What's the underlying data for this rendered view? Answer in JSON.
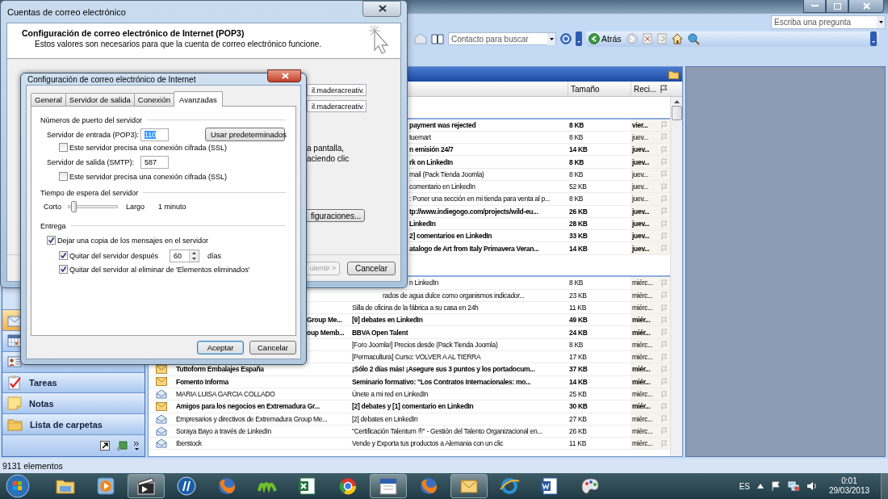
{
  "outlook": {
    "question_box": {
      "placeholder": "Escriba una pregunta"
    },
    "contact_search": {
      "placeholder": "Contacto para buscar"
    },
    "back_button": "Atrás",
    "navigation": [
      {
        "kind": "mail",
        "selected": true
      },
      {
        "kind": "calendar",
        "selected": false
      },
      {
        "kind": "contacts",
        "selected": false
      },
      {
        "kind": "tasks",
        "label": "Tareas",
        "selected": false
      },
      {
        "kind": "notes",
        "label": "Notas",
        "selected": false
      },
      {
        "kind": "folders",
        "label": "Lista de carpetas",
        "selected": false
      }
    ],
    "mail_list": {
      "columns": [
        "Tamaño",
        "Reci..."
      ],
      "groups": [
        {
          "rows": [
            {
              "kind": "subject_c",
              "subject": "payment was rejected",
              "size": "8 KB",
              "received": "vier...",
              "unread": true
            },
            {
              "kind": "subject_c",
              "subject": "tuemart",
              "size": "8 KB",
              "received": "juev...",
              "unread": false
            },
            {
              "kind": "subject_c",
              "subject": "n emisión 24/7",
              "size": "14 KB",
              "received": "juev...",
              "unread": true
            },
            {
              "kind": "subject_c",
              "subject": "rk on LinkedIn",
              "size": "8 KB",
              "received": "juev...",
              "unread": true
            },
            {
              "kind": "subject_c",
              "subject": "mail (Pack Tienda Joomla)",
              "size": "8 KB",
              "received": "juev...",
              "unread": false
            },
            {
              "kind": "subject_c",
              "subject": "comentario en LinkedIn",
              "size": "52 KB",
              "received": "juev...",
              "unread": false
            },
            {
              "kind": "subject_c",
              "subject": ": Poner una sección en mi tienda para venta al p...",
              "size": "8 KB",
              "received": "juev...",
              "unread": false
            },
            {
              "kind": "subject_c",
              "subject": "tp://www.indiegogo.com/projects/wild-eu...",
              "size": "26 KB",
              "received": "juev...",
              "unread": true
            },
            {
              "kind": "subject_c",
              "subject": "LinkedIn",
              "size": "28 KB",
              "received": "juev...",
              "unread": true
            },
            {
              "kind": "subject_c",
              "subject": "2] comentarios en LinkedIn",
              "size": "33 KB",
              "received": "juev...",
              "unread": true
            },
            {
              "kind": "subject_c",
              "subject": "atalogo de Art from Italy Primavera Veran...",
              "size": "14 KB",
              "received": "juev...",
              "unread": true
            }
          ]
        },
        {
          "rows": [
            {
              "kind": "subject_c",
              "subject": "n LinkedIn",
              "size": "8 KB",
              "received": "miérc...",
              "unread": false
            },
            {
              "kind": "subject_b",
              "subject": "rados de agua dulce como organismos indicador...",
              "size": "23 KB",
              "received": "miérc...",
              "unread": false
            },
            {
              "kind": "subject_a",
              "subject": "Silla de oficina de la fábrica a su casa en 24h",
              "size": "11 KB",
              "received": "miérc...",
              "unread": false
            },
            {
              "kind": "sender_cut",
              "sender": "Group Me...",
              "subject": "[9] debates en LinkedIn",
              "size": "49 KB",
              "received": "miér...",
              "unread": true
            },
            {
              "kind": "sender_cut",
              "sender": "oup Memb...",
              "subject": "BBVA Open Talent",
              "size": "24 KB",
              "received": "miér...",
              "unread": true
            },
            {
              "kind": "subject_a",
              "subject": "[Foro Joomla!] Precios desde (Pack Tienda Joomla)",
              "size": "8 KB",
              "received": "miérc...",
              "unread": false
            },
            {
              "kind": "subject_a",
              "subject": "[Permacultura] Curso: VOLVER A AL TIERRA",
              "size": "17 KB",
              "received": "miérc...",
              "unread": false
            },
            {
              "kind": "full",
              "sender": "Tuttoform Embalajes España",
              "subject": "¡Sólo 2 días más! ¡Asegure sus 3 puntos y los portadocum...",
              "size": "37 KB",
              "received": "miér...",
              "unread": true
            },
            {
              "kind": "full",
              "sender": "Fomento Informa",
              "subject": "Seminario formativo: \"Los Contratos Internacionales: mo...",
              "size": "14 KB",
              "received": "miér...",
              "unread": true
            },
            {
              "kind": "full",
              "sender": "MARIA LUISA GARCIA COLLADO",
              "subject": "Únete a mi red en LinkedIn",
              "size": "25 KB",
              "received": "miérc...",
              "unread": false
            },
            {
              "kind": "full",
              "sender": "Amigos para los negocios en Extremadura Gr...",
              "subject": "[2] debates y [1] comentario en LinkedIn",
              "size": "30 KB",
              "received": "miér...",
              "unread": true
            },
            {
              "kind": "full",
              "sender": "Empresarios y directivos de Extremadura Group Me...",
              "subject": "[2] debates en LinkedIn",
              "size": "27 KB",
              "received": "miérc...",
              "unread": false
            },
            {
              "kind": "full",
              "sender": "Soraya Bayo a través de LinkedIn",
              "subject": "\"Certificación Talentum ®\" - Gestión del Talento Organizacional  en...",
              "size": "26 KB",
              "received": "miérc...",
              "unread": false
            },
            {
              "kind": "full",
              "sender": "Iberstock",
              "subject": "Vende y Exporta tus productos a Alemania con un clic",
              "size": "11 KB",
              "received": "miérc...",
              "unread": false
            }
          ]
        }
      ]
    },
    "status_bar": "9131 elementos"
  },
  "accounts_dialog": {
    "title": "Cuentas de correo electrónico",
    "heading": "Configuración de correo electrónico de Internet (POP3)",
    "subheading": "Estos valores son necesarios para que la cuenta de correo electrónico funcione.",
    "fields": [
      "il.maderacreativ.",
      "il.maderacreativ."
    ],
    "note_lines": [
      "a pantalla,",
      "aciendo clic"
    ],
    "more_settings_button": "figuraciones...",
    "next_button": {
      "label": "uiente >",
      "disabled": true
    },
    "cancel_button": "Cancelar"
  },
  "settings_dialog": {
    "title": "Configuración de correo electrónico de Internet",
    "tabs": [
      {
        "label": "General",
        "selected": false
      },
      {
        "label": "Servidor de salida",
        "selected": false
      },
      {
        "label": "Conexión",
        "selected": false
      },
      {
        "label": "Avanzadas",
        "selected": true
      }
    ],
    "port_section": "Números de puerto del servidor",
    "incoming": {
      "label": "Servidor de entrada (POP3):",
      "value": "110",
      "text_selected": true
    },
    "defaults_button": "Usar predeterminados",
    "incoming_ssl": {
      "label": "Este servidor precisa una conexión cifrada (SSL)",
      "checked": false
    },
    "outgoing": {
      "label": "Servidor de salida (SMTP):",
      "value": "587",
      "text_selected": false
    },
    "outgoing_ssl": {
      "label": "Este servidor precisa una conexión cifrada (SSL)",
      "checked": false
    },
    "timeout_section": "Tiempo de espera del servidor",
    "timeout": {
      "min_label": "Corto",
      "max_label": "Largo",
      "level": 0.12,
      "reading": "1 minuto"
    },
    "delivery_section": "Entrega",
    "leave_copy": {
      "label": "Dejar una copia de los mensajes en el servidor",
      "checked": true
    },
    "remove_after": {
      "label": "Quitar del servidor después",
      "checked": true,
      "value": "60",
      "unit": "días"
    },
    "remove_deleted": {
      "label": "Quitar del servidor al eliminar de 'Elementos eliminados'",
      "checked": true
    },
    "buttons": [
      {
        "label": "Aceptar",
        "default": true
      },
      {
        "label": "Cancelar",
        "default": false
      }
    ]
  },
  "taskbar": {
    "apps": [
      {
        "kind": "folder",
        "active": false
      },
      {
        "kind": "media",
        "active": false
      },
      {
        "kind": "clapper",
        "active": true
      },
      {
        "kind": "circle",
        "active": false
      },
      {
        "kind": "fox",
        "active": false
      },
      {
        "kind": "wave",
        "active": false
      },
      {
        "kind": "sheet",
        "active": false
      },
      {
        "kind": "wheel",
        "active": false
      },
      {
        "kind": "calendar",
        "active": true
      },
      {
        "kind": "fox",
        "active": false
      },
      {
        "kind": "mail",
        "active": true
      },
      {
        "kind": "ring",
        "active": false
      },
      {
        "kind": "doc",
        "active": false
      },
      {
        "kind": "palette",
        "active": false
      }
    ],
    "language": "ES",
    "time": "0:01",
    "date": "29/03/2013"
  }
}
